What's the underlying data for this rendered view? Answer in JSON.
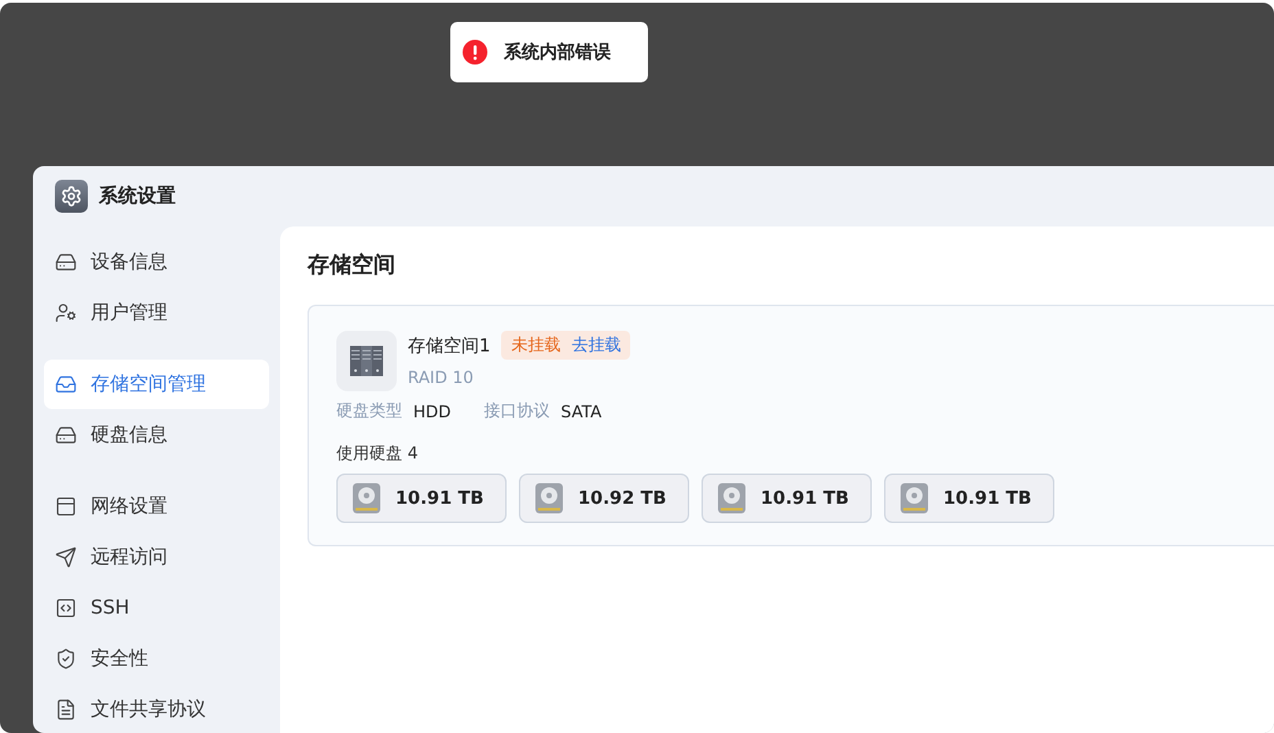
{
  "toast": {
    "text": "系统内部错误"
  },
  "window": {
    "title": "系统设置"
  },
  "sidebar": {
    "groups": [
      [
        {
          "label": "设备信息",
          "selected": false
        },
        {
          "label": "用户管理",
          "selected": false
        }
      ],
      [
        {
          "label": "存储空间管理",
          "selected": true
        },
        {
          "label": "硬盘信息",
          "selected": false
        }
      ],
      [
        {
          "label": "网络设置",
          "selected": false
        },
        {
          "label": "远程访问",
          "selected": false
        },
        {
          "label": "SSH",
          "selected": false
        },
        {
          "label": "安全性",
          "selected": false
        },
        {
          "label": "文件共享协议",
          "selected": false
        }
      ]
    ]
  },
  "content": {
    "title": "存储空间",
    "pool": {
      "name": "存储空间1",
      "status": "未挂载",
      "action": "去挂载",
      "raid": "RAID 10",
      "fields": [
        {
          "label": "硬盘类型",
          "value": "HDD"
        },
        {
          "label": "接口协议",
          "value": "SATA"
        }
      ],
      "disks_label": "使用硬盘 4",
      "disks": [
        {
          "size": "10.91 TB"
        },
        {
          "size": "10.92 TB"
        },
        {
          "size": "10.91 TB"
        },
        {
          "size": "10.91 TB"
        }
      ]
    }
  }
}
